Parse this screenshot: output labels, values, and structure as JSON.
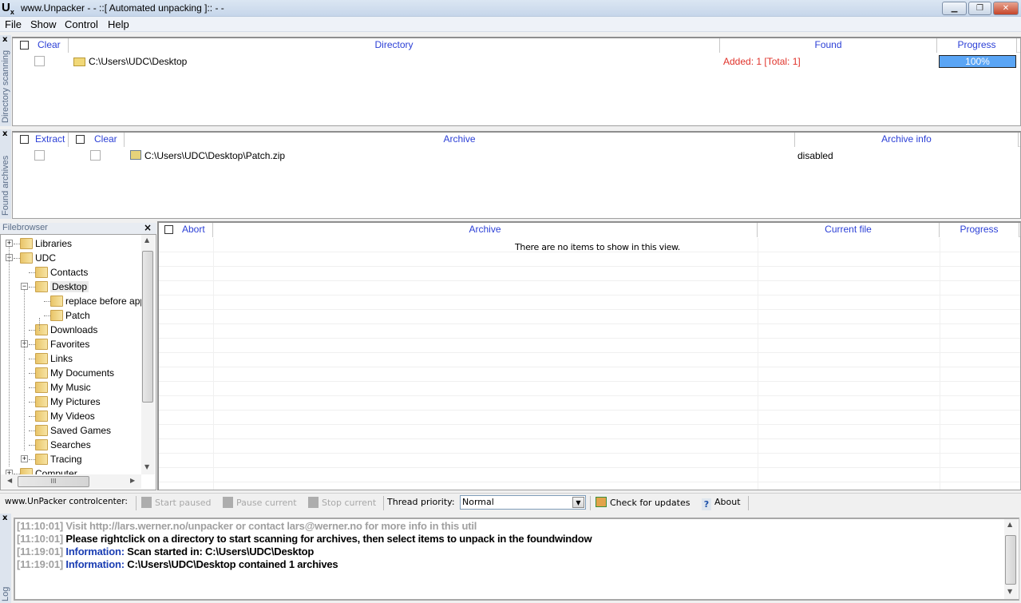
{
  "window": {
    "logo": "U",
    "logo_sub": "x",
    "title": "www.Unpacker - - ::[ Automated unpacking ]:: - -",
    "minimize": "▁",
    "restore": "❐",
    "close": "✕"
  },
  "menu": [
    "File",
    "Show",
    "Control",
    "Help"
  ],
  "directory_scanning": {
    "side_label": "Directory scanning",
    "close": "x",
    "headers": {
      "clear": "Clear",
      "directory": "Directory",
      "found": "Found",
      "progress": "Progress"
    },
    "rows": [
      {
        "directory": "C:\\Users\\UDC\\Desktop",
        "found": "Added: 1 [Total: 1]",
        "progress_label": "100%",
        "progress_percent": 100
      }
    ]
  },
  "found_archives": {
    "side_label": "Found archives",
    "close": "x",
    "headers": {
      "extract": "Extract",
      "clear": "Clear",
      "archive": "Archive",
      "archive_info": "Archive info"
    },
    "rows": [
      {
        "archive": "C:\\Users\\UDC\\Desktop\\Patch.zip",
        "archive_info": "disabled"
      }
    ]
  },
  "filebrowser": {
    "title": "Filebrowser",
    "close": "×",
    "items": [
      {
        "label": "Libraries",
        "level": 0,
        "expander": "+"
      },
      {
        "label": "UDC",
        "level": 0,
        "expander": "−"
      },
      {
        "label": "Contacts",
        "level": 1,
        "expander": ""
      },
      {
        "label": "Desktop",
        "level": 1,
        "expander": "−"
      },
      {
        "label": "replace before app",
        "level": 2,
        "expander": ""
      },
      {
        "label": "Patch",
        "level": 2,
        "expander": ""
      },
      {
        "label": "Downloads",
        "level": 1,
        "expander": ""
      },
      {
        "label": "Favorites",
        "level": 1,
        "expander": "+"
      },
      {
        "label": "Links",
        "level": 1,
        "expander": ""
      },
      {
        "label": "My Documents",
        "level": 1,
        "expander": ""
      },
      {
        "label": "My Music",
        "level": 1,
        "expander": ""
      },
      {
        "label": "My Pictures",
        "level": 1,
        "expander": ""
      },
      {
        "label": "My Videos",
        "level": 1,
        "expander": ""
      },
      {
        "label": "Saved Games",
        "level": 1,
        "expander": ""
      },
      {
        "label": "Searches",
        "level": 1,
        "expander": ""
      },
      {
        "label": "Tracing",
        "level": 1,
        "expander": "+"
      },
      {
        "label": "Computer",
        "level": 0,
        "expander": "+"
      }
    ],
    "hscroll_grip": "III"
  },
  "queue": {
    "headers": {
      "abort": "Abort",
      "archive": "Archive",
      "current_file": "Current file",
      "progress": "Progress"
    },
    "empty_text": "There are no items to show in this view."
  },
  "toolbar": {
    "label": "www.UnPacker controlcenter:",
    "start_paused": "Start paused",
    "pause_current": "Pause current",
    "stop_current": "Stop current",
    "thread_priority_label": "Thread priority:",
    "thread_priority_value": "Normal",
    "check_updates": "Check for updates",
    "about": "About"
  },
  "log": {
    "side_label": "Log",
    "close": "x",
    "lines": [
      {
        "time": "[11:10:01]",
        "prefix": "",
        "text": "Visit http://lars.werner.no/unpacker or contact lars@werner.no for more info in this util",
        "muted": true
      },
      {
        "time": "[11:10:01]",
        "prefix": "",
        "text": "Please rightclick on a directory to start scanning for archives, then select items to unpack in the foundwindow",
        "muted": false
      },
      {
        "time": "[11:19:01]",
        "prefix": "Information:",
        "text": "Scan started in: C:\\Users\\UDC\\Desktop",
        "muted": false
      },
      {
        "time": "[11:19:01]",
        "prefix": "Information:",
        "text": "C:\\Users\\UDC\\Desktop contained 1 archives",
        "muted": false
      }
    ]
  },
  "colors": {
    "header_text": "#2b3fd6",
    "found_text": "#e0322a",
    "progress_fill": "#5aa5f5",
    "info_text": "#1b3eb3"
  }
}
